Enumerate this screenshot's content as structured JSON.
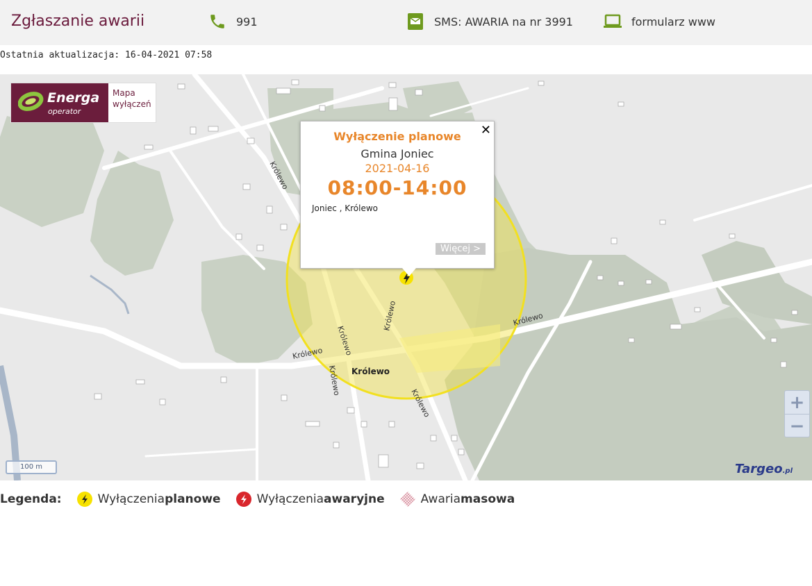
{
  "header": {
    "title": "Zgłaszanie awarii",
    "phone": "991",
    "sms": "SMS: AWARIA na nr 3991",
    "www": "formularz www"
  },
  "last_update": "Ostatnia aktualizacja: 16-04-2021 07:58",
  "logo": {
    "brand": "Energa",
    "sub": "operator",
    "map_label_1": "Mapa",
    "map_label_2": "wyłączeń"
  },
  "map": {
    "street_labels": [
      "Królewo",
      "Królewo",
      "Królewo",
      "Królewo",
      "Królewo",
      "Królewo"
    ],
    "place_label": "Królewo",
    "scale": "100 m",
    "provider": "Targeo",
    "provider_suffix": ".pl",
    "zoom_in": "+",
    "zoom_out": "−"
  },
  "popup": {
    "title": "Wyłączenie planowe",
    "gmina": "Gmina Joniec",
    "date": "2021-04-16",
    "time": "08:00-14:00",
    "locations": "Joniec , Królewo",
    "more": "Więcej >",
    "close": "✕"
  },
  "legend": {
    "label": "Legenda:",
    "items": [
      {
        "text": "Wyłączenia ",
        "bold": "planowe",
        "icon": "yellow-lightning-icon"
      },
      {
        "text": "Wyłączenia ",
        "bold": "awaryjne",
        "icon": "red-lightning-icon"
      },
      {
        "text": "Awaria ",
        "bold": "masowa",
        "icon": "hatched-area-icon"
      }
    ]
  },
  "colors": {
    "accent": "#6a1a3c",
    "planned": "#e8862a",
    "icon_green": "#6e9a1e",
    "outage_zone": "#f2e34a"
  }
}
